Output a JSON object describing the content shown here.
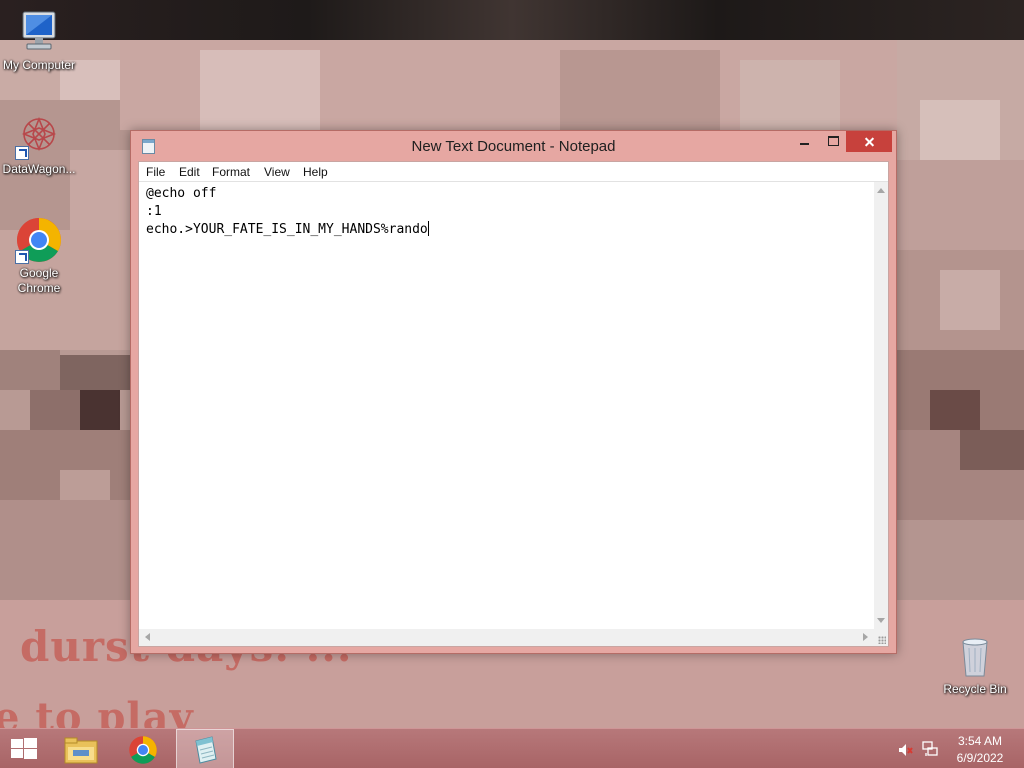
{
  "desktop": {
    "icons": [
      {
        "label": "My Computer",
        "icon": "computer-icon"
      },
      {
        "label": "DataWagon...",
        "icon": "datawagon-icon"
      },
      {
        "label": "Google Chrome",
        "icon": "chrome-icon"
      },
      {
        "label": "Recycle Bin",
        "icon": "recycle-bin-icon"
      }
    ],
    "wallpaper_text": {
      "line1": "durst days. ...",
      "line2": "e to play"
    }
  },
  "notepad": {
    "title": "New Text Document - Notepad",
    "menu": [
      "File",
      "Edit",
      "Format",
      "View",
      "Help"
    ],
    "lines": [
      "@echo off",
      ":1",
      "echo.>YOUR_FATE_IS_IN_MY_HANDS%rando"
    ]
  },
  "taskbar": {
    "pinned": [
      "start-icon",
      "file-explorer-icon",
      "chrome-icon",
      "notepad-icon"
    ],
    "tray": {
      "icons": [
        "speaker-muted-icon",
        "network-icon"
      ],
      "time": "3:54 AM",
      "date": "6/9/2022"
    }
  },
  "colors": {
    "window_frame": "#e6a7a2",
    "close_button": "#c7413c",
    "taskbar": "#b0696b"
  }
}
